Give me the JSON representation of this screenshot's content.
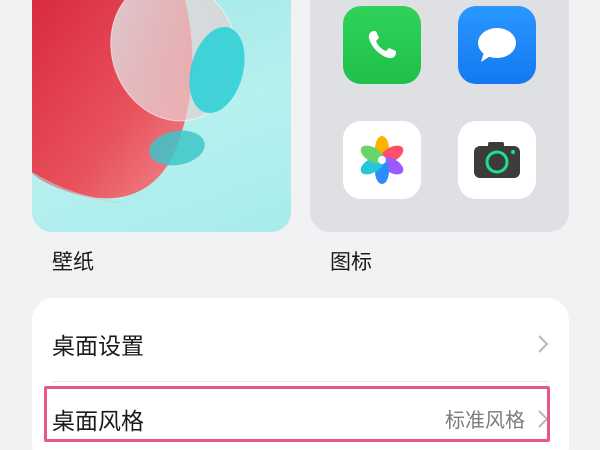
{
  "cards": {
    "wallpaper_label": "壁纸",
    "icons_label": "图标"
  },
  "icons": [
    "phone-icon",
    "messages-icon",
    "photos-icon",
    "camera-icon"
  ],
  "settings": {
    "desktop_settings_label": "桌面设置",
    "desktop_style_label": "桌面风格",
    "desktop_style_value": "标准风格"
  },
  "colors": {
    "highlight": "#e8568a",
    "phone": "#1fbf4a",
    "messages": "#1479f0"
  }
}
